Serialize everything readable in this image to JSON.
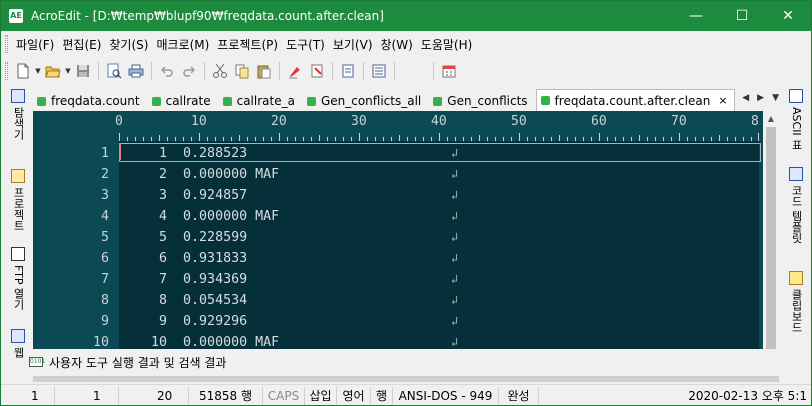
{
  "window": {
    "app_icon_text": "AE",
    "title": "AcroEdit - [D:₩temp₩blupf90₩freqdata.count.after.clean]",
    "min_glyph": "—",
    "max_glyph": "☐",
    "close_glyph": "✕"
  },
  "menu": {
    "items": [
      "파일(F)",
      "편집(E)",
      "찾기(S)",
      "매크로(M)",
      "프로젝트(P)",
      "도구(T)",
      "보기(V)",
      "창(W)",
      "도움말(H)"
    ]
  },
  "side_left": {
    "tabs": [
      "탐색기",
      "프로젝트",
      "FTP 열기",
      "웹"
    ]
  },
  "side_right": {
    "tabs": [
      "ASCII 표",
      "코드 템플릿",
      "클립보드"
    ]
  },
  "tabs": {
    "items": [
      {
        "label": "freqdata.count"
      },
      {
        "label": "callrate"
      },
      {
        "label": "callrate_a"
      },
      {
        "label": "Gen_conflicts_all"
      },
      {
        "label": "Gen_conflicts"
      },
      {
        "label": "freqdata.count.after.clean",
        "close": "×"
      }
    ],
    "nav_prev": "◀",
    "nav_next": "▶",
    "nav_menu": "▼"
  },
  "ruler": {
    "labels": [
      "0",
      "10",
      "20",
      "30",
      "40",
      "50",
      "60",
      "70",
      "8"
    ]
  },
  "editor": {
    "eol_glyph": "↲",
    "lines": [
      {
        "num": "1",
        "text": "     1  0.288523"
      },
      {
        "num": "2",
        "text": "     2  0.000000 MAF"
      },
      {
        "num": "3",
        "text": "     3  0.924857"
      },
      {
        "num": "4",
        "text": "     4  0.000000 MAF"
      },
      {
        "num": "5",
        "text": "     5  0.228599"
      },
      {
        "num": "6",
        "text": "     6  0.931833"
      },
      {
        "num": "7",
        "text": "     7  0.934369"
      },
      {
        "num": "8",
        "text": "     8  0.054534"
      },
      {
        "num": "9",
        "text": "     9  0.929296"
      },
      {
        "num": "10",
        "text": "    10  0.000000 MAF"
      }
    ]
  },
  "output": {
    "icon_text": "0101",
    "label": "사용자 도구 실행 결과 및 검색 결과"
  },
  "status": {
    "line": "1",
    "col": "1",
    "count": "20",
    "total_lines": "51858 행",
    "caps": "CAPS",
    "insert": "삽입",
    "lang": "영어",
    "row_mode": "행",
    "encoding": "ANSI-DOS - 949",
    "state": "완성",
    "datetime": "2020-02-13  오후 5:1"
  }
}
